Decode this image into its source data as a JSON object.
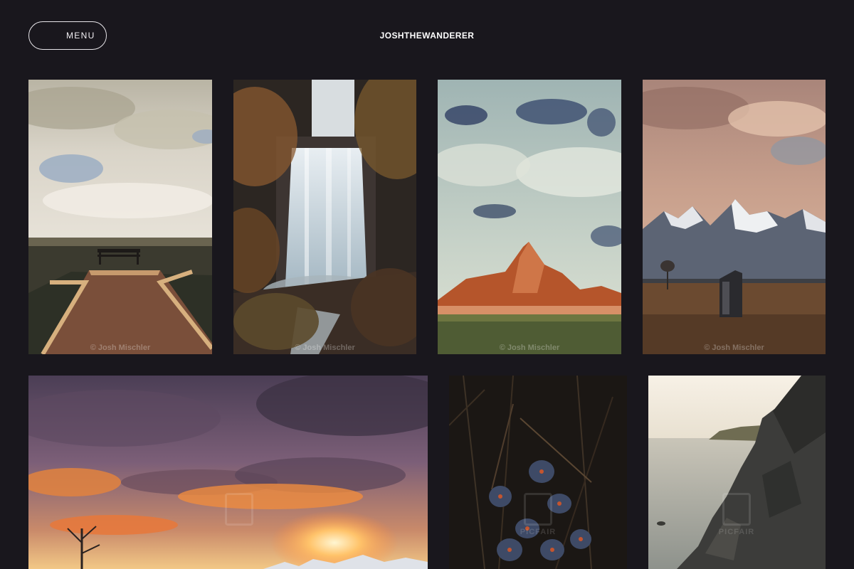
{
  "header": {
    "menu_label": "MENU",
    "site_title": "JOSHTHEWANDERER"
  },
  "gallery": {
    "photos": [
      {
        "subject": "boardwalk-bench",
        "credit": "© Josh Mischler"
      },
      {
        "subject": "waterfall",
        "credit": "© Josh Mischler"
      },
      {
        "subject": "badlands-butte",
        "credit": "© Josh Mischler"
      },
      {
        "subject": "mountain-outhouse",
        "credit": "© Josh Mischler"
      },
      {
        "subject": "sunset-sky",
        "watermark": ""
      },
      {
        "subject": "blue-flowers",
        "watermark": "PICFAIR"
      },
      {
        "subject": "sea-cliff",
        "watermark": "PICFAIR"
      }
    ]
  },
  "colors": {
    "background": "#19171d",
    "header_text": "#ffffff"
  }
}
